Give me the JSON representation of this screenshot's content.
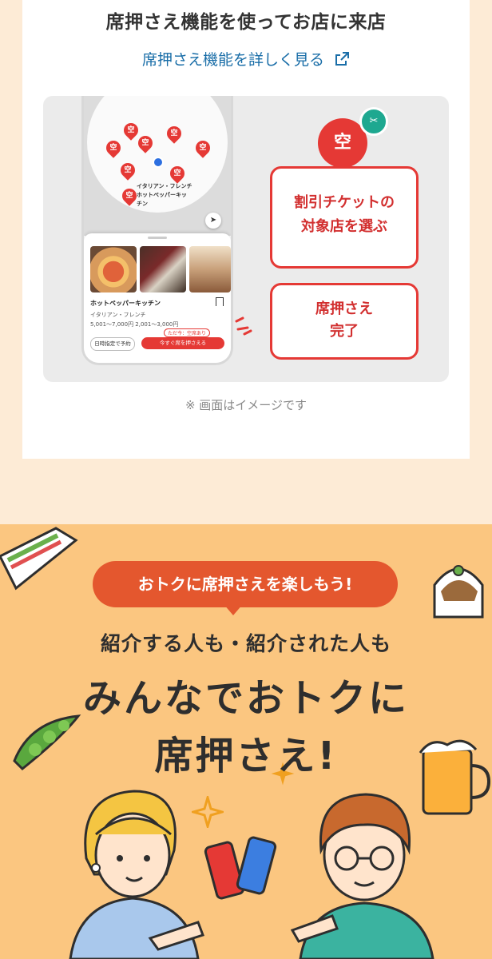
{
  "section": {
    "title": "席押さえ機能を使ってお店に来店",
    "detail_link": "席押さえ機能を詳しく見る",
    "note": "※ 画面はイメージです"
  },
  "illustration": {
    "badge_char": "空",
    "bubble1_line1": "割引チケットの",
    "bubble1_line2": "対象店を選ぶ",
    "bubble2_line1": "席押さえ",
    "bubble2_line2": "完了",
    "map": {
      "pin_char": "空",
      "label_line1": "イタリアン・フレンチ",
      "label_line2": "ホットペッパーキッ",
      "label_line3": "チン"
    },
    "shop": {
      "name": "ホットペッパーキッチン",
      "genre": "イタリアン・フレンチ",
      "price": "5,001〜7,000円  2,001〜3,000円",
      "pr_note": "ただ今：空席あり",
      "date_button": "日時指定で予約",
      "now_button": "今すぐ席を押さえる"
    }
  },
  "banner": {
    "pill": "おトクに席押さえを楽しもう!",
    "sub": "紹介する人も・紹介された人も",
    "main_line1": "みんなでおトクに",
    "main_line2": "席押さえ!"
  },
  "colors": {
    "accent_red": "#e53935",
    "link_blue": "#1a6ea8",
    "banner_bg": "#fbc680",
    "pill_orange": "#e4572e"
  }
}
